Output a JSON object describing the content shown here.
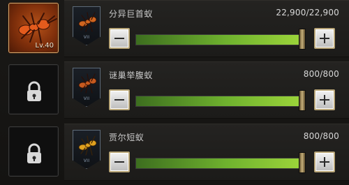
{
  "rows": [
    {
      "slot": {
        "level_text": "Lv.40",
        "state": "active"
      },
      "card": {
        "grade": "VII"
      },
      "name": "分异巨首蚁",
      "value": "22,900/22,900",
      "progress": 1.0
    },
    {
      "slot": {
        "state": "locked"
      },
      "card": {
        "grade": "VII"
      },
      "name": "谜巢举腹蚁",
      "value": "800/800",
      "progress": 1.0
    },
    {
      "slot": {
        "state": "locked"
      },
      "card": {
        "grade": "VII"
      },
      "name": "贾尔短蚁",
      "value": "800/800",
      "progress": 1.0
    }
  ],
  "icons": {
    "lock": "lock-icon",
    "minus": "minus-icon",
    "plus": "plus-icon",
    "ant": "ant-icon"
  },
  "colors": {
    "accent_gold": "#b8a577",
    "progress_green": "#6fb22e",
    "active_slot": "#b65219"
  }
}
